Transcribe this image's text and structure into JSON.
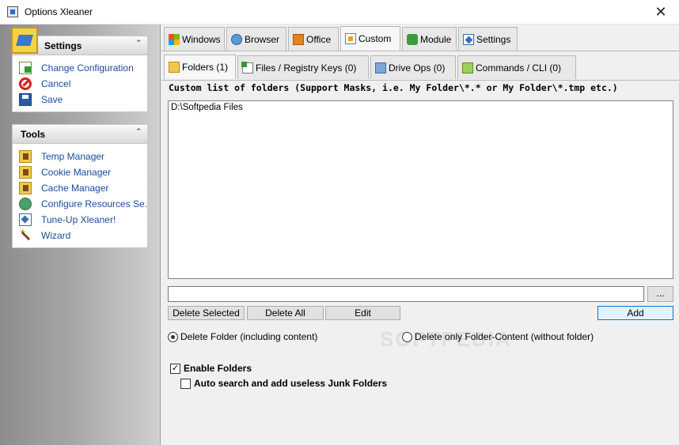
{
  "window": {
    "title": "Options Xleaner",
    "close_glyph": "✕"
  },
  "sidebar": {
    "settings_panel": {
      "title": "Settings",
      "items": [
        {
          "label": "Change Configuration",
          "icon": "change-config-icon"
        },
        {
          "label": "Cancel",
          "icon": "cancel-icon"
        },
        {
          "label": "Save",
          "icon": "save-icon"
        }
      ]
    },
    "tools_panel": {
      "title": "Tools",
      "items": [
        {
          "label": "Temp Manager",
          "icon": "temp-manager-icon"
        },
        {
          "label": "Cookie Manager",
          "icon": "cookie-manager-icon"
        },
        {
          "label": "Cache Manager",
          "icon": "cache-manager-icon"
        },
        {
          "label": "Configure Resources Se...",
          "icon": "configure-resources-icon"
        },
        {
          "label": "Tune-Up Xleaner!",
          "icon": "tune-up-icon"
        },
        {
          "label": "Wizard",
          "icon": "wizard-icon"
        }
      ]
    },
    "collapse_glyph": "⌃"
  },
  "main_tabs": [
    {
      "label": "Windows",
      "icon": "windows-icon"
    },
    {
      "label": "Browser",
      "icon": "browser-icon"
    },
    {
      "label": "Office",
      "icon": "office-icon"
    },
    {
      "label": "Custom",
      "icon": "custom-icon",
      "active": true
    },
    {
      "label": "Module",
      "icon": "module-icon"
    },
    {
      "label": "Settings",
      "icon": "settings-icon"
    }
  ],
  "sub_tabs": [
    {
      "label": "Folders (1)",
      "icon": "folder-icon",
      "active": true
    },
    {
      "label": "Files / Registry Keys (0)",
      "icon": "files-icon"
    },
    {
      "label": "Drive Ops (0)",
      "icon": "drive-icon"
    },
    {
      "label": "Commands / CLI (0)",
      "icon": "commands-icon"
    }
  ],
  "folders": {
    "section_label": "Custom list of folders (Support Masks, i.e. My Folder\\*.* or My Folder\\*.tmp etc.)",
    "list": [
      "D:\\Softpedia Files"
    ],
    "path_input_value": "",
    "browse_label": "...",
    "buttons": {
      "delete_selected": "Delete Selected",
      "delete_all": "Delete All",
      "edit": "Edit",
      "add": "Add"
    },
    "radio_delete_folder": "Delete Folder (including content)",
    "radio_delete_content": "Delete only Folder-Content (without folder)",
    "radio_selected": "delete_folder",
    "enable_folders": {
      "label": "Enable Folders",
      "checked": true
    },
    "auto_search": {
      "label": "Auto search and add useless Junk Folders",
      "checked": false
    },
    "check_glyph": "✓"
  },
  "watermark": "SOFTPEDIA"
}
